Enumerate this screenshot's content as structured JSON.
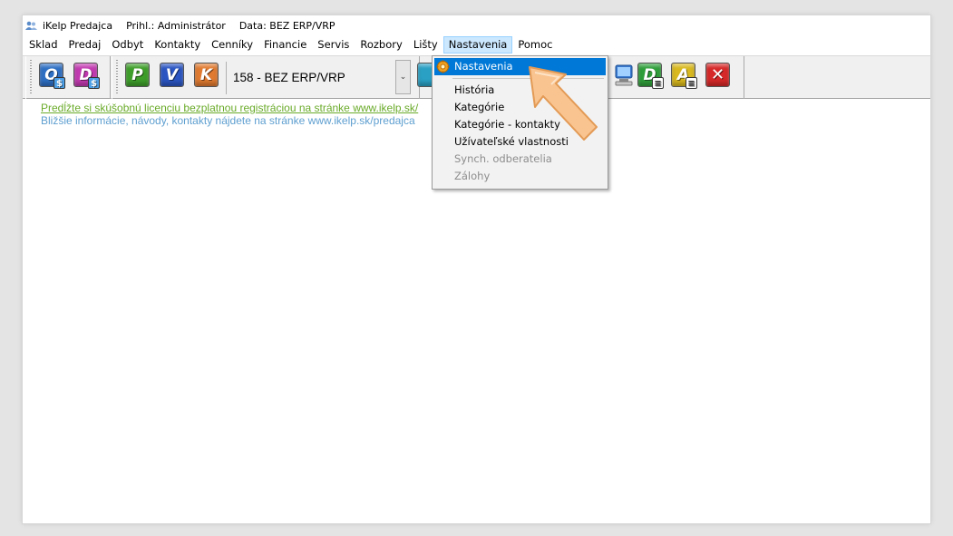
{
  "titlebar": {
    "app_name": "iKelp Predajca",
    "login": "Prihl.: Administrátor",
    "data": "Data: BEZ ERP/VRP"
  },
  "menubar": {
    "items": [
      "Sklad",
      "Predaj",
      "Odbyt",
      "Kontakty",
      "Cenníky",
      "Financie",
      "Servis",
      "Rozbory",
      "Lišty",
      "Nastavenia",
      "Pomoc"
    ],
    "active": "Nastavenia"
  },
  "toolbar": {
    "left_buttons": [
      {
        "letter": "O",
        "badge": "$",
        "color": "#2e6fc4"
      },
      {
        "letter": "D",
        "badge": "$",
        "color": "#c23ab0"
      }
    ],
    "mid_buttons": [
      {
        "letter": "P",
        "color": "#3e9e2a"
      },
      {
        "letter": "V",
        "color": "#2a55c2"
      },
      {
        "letter": "K",
        "color": "#e07a30"
      }
    ],
    "right_buttons": [
      {
        "letter": "D",
        "color": "#2f9e3a"
      },
      {
        "letter": "A",
        "color": "#d8b81e"
      }
    ],
    "combo_value": "158 - BEZ ERP/VRP"
  },
  "content": {
    "promo_text": "Predĺžte si skúšobnú licenciu bezplatnou registráciou na stránke www.ikelp.sk/",
    "info_text": "Bližšie informácie, návody, kontakty nájdete na stránke www.ikelp.sk/predajca"
  },
  "dropdown": {
    "selected": "Nastavenia",
    "items": [
      {
        "label": "História",
        "enabled": true
      },
      {
        "label": "Kategórie",
        "enabled": true
      },
      {
        "label": "Kategórie - kontakty",
        "enabled": true
      },
      {
        "label": "Užívateľské vlastnosti",
        "enabled": true
      },
      {
        "label": "Synch. odberatelia",
        "enabled": false
      },
      {
        "label": "Zálohy",
        "enabled": false
      }
    ]
  },
  "colors": {
    "selection": "#0078d7",
    "menu_active_bg": "#cce8ff",
    "promo_link": "#6aab2a",
    "info_text": "#5e9fd0",
    "pointer_arrow": "#f7c08a"
  }
}
